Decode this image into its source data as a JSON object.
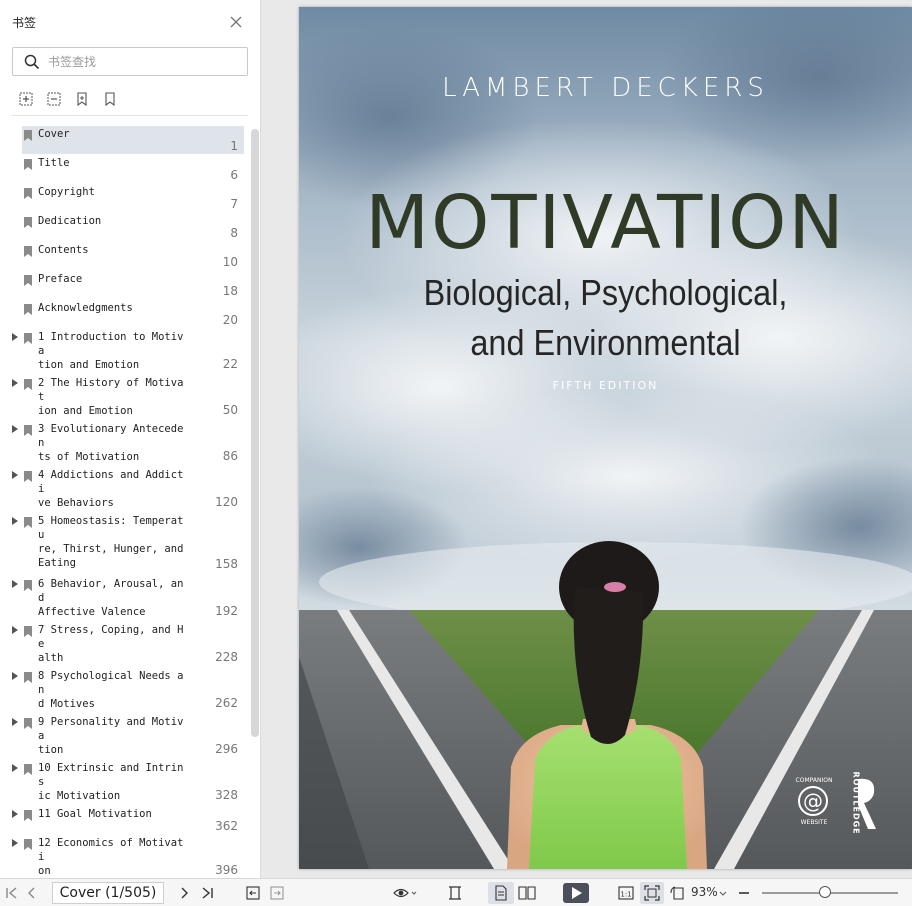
{
  "sidebar": {
    "title": "书签",
    "search_placeholder": "书签查找",
    "toc": [
      {
        "label": "Cover",
        "page": "1",
        "expandable": false,
        "selected": true
      },
      {
        "label": "Title",
        "page": "6",
        "expandable": false
      },
      {
        "label": "Copyright",
        "page": "7",
        "expandable": false
      },
      {
        "label": "Dedication",
        "page": "8",
        "expandable": false
      },
      {
        "label": "Contents",
        "page": "10",
        "expandable": false
      },
      {
        "label": "Preface",
        "page": "18",
        "expandable": false
      },
      {
        "label": "Acknowledgments",
        "page": "20",
        "expandable": false
      },
      {
        "label": "1 Introduction to Motiva\ntion and Emotion",
        "page": "22",
        "expandable": true
      },
      {
        "label": "2 The History of Motivat\nion and Emotion",
        "page": "50",
        "expandable": true
      },
      {
        "label": "3 Evolutionary Anteceden\nts of Motivation",
        "page": "86",
        "expandable": true
      },
      {
        "label": "4 Addictions and Addicti\nve Behaviors",
        "page": "120",
        "expandable": true
      },
      {
        "label": "5 Homeostasis: Temperatu\nre, Thirst, Hunger, and\nEating",
        "page": "158",
        "expandable": true
      },
      {
        "label": "6 Behavior, Arousal, and\nAffective Valence",
        "page": "192",
        "expandable": true
      },
      {
        "label": "7 Stress, Coping, and He\nalth",
        "page": "228",
        "expandable": true
      },
      {
        "label": "8 Psychological Needs an\nd Motives",
        "page": "262",
        "expandable": true
      },
      {
        "label": "9 Personality and Motiva\ntion",
        "page": "296",
        "expandable": true
      },
      {
        "label": "10 Extrinsic and Intrins\nic Motivation",
        "page": "328",
        "expandable": true
      },
      {
        "label": "11 Goal Motivation",
        "page": "362",
        "expandable": true
      },
      {
        "label": "12 Economics of Motivati\non",
        "page": "396",
        "expandable": true
      }
    ]
  },
  "cover": {
    "author": "LAMBERT DECKERS",
    "title": "MOTIVATION",
    "subtitle_line1": "Biological, Psychological,",
    "subtitle_line2": "and Environmental",
    "edition": "FIFTH EDITION",
    "companion_badge_top": "COMPANION",
    "companion_badge_bottom": "WEBSITE",
    "publisher": "ROUTLEDGE"
  },
  "statusbar": {
    "page_field": "Cover (1/505)",
    "zoom": "93%"
  },
  "colors": {
    "selected_row": "#dfe3ea",
    "title_green": "#2f3b26"
  }
}
